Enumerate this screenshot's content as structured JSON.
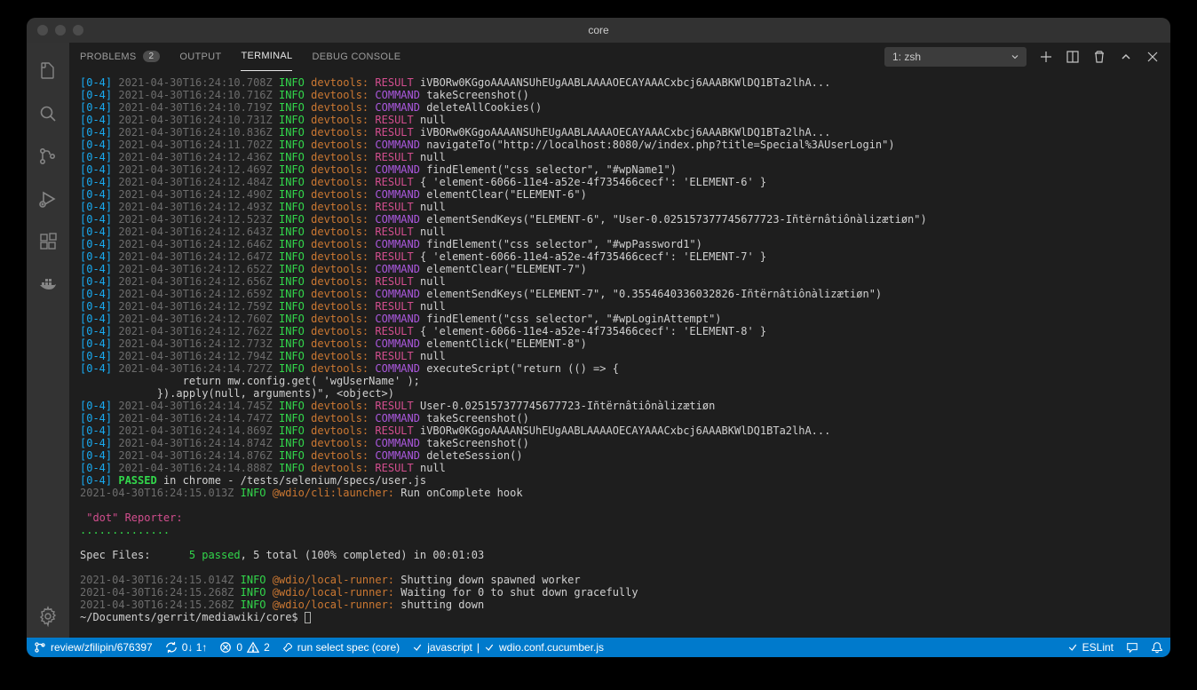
{
  "window": {
    "title": "core"
  },
  "panel_tabs": {
    "problems": "PROBLEMS",
    "problems_badge": "2",
    "output": "OUTPUT",
    "terminal": "TERMINAL",
    "debug_console": "DEBUG CONSOLE"
  },
  "terminal_select": "1: zsh",
  "log": {
    "prefix": "[0-4]",
    "info": "INFO",
    "source": "devtools:",
    "result": "RESULT",
    "command": "COMMAND",
    "lines": [
      {
        "ts": "2021-04-30T16:24:10.708Z",
        "kind": "RESULT",
        "msg": "iVBORw0KGgoAAAANSUhEUgAABLAAAAOECAYAAACxbcj6AAABKWlDQ1BTa2lhA..."
      },
      {
        "ts": "2021-04-30T16:24:10.716Z",
        "kind": "COMMAND",
        "msg": "takeScreenshot()"
      },
      {
        "ts": "2021-04-30T16:24:10.719Z",
        "kind": "COMMAND",
        "msg": "deleteAllCookies()"
      },
      {
        "ts": "2021-04-30T16:24:10.731Z",
        "kind": "RESULT",
        "msg": "null"
      },
      {
        "ts": "2021-04-30T16:24:10.836Z",
        "kind": "RESULT",
        "msg": "iVBORw0KGgoAAAANSUhEUgAABLAAAAOECAYAAACxbcj6AAABKWlDQ1BTa2lhA..."
      },
      {
        "ts": "2021-04-30T16:24:11.702Z",
        "kind": "COMMAND",
        "msg": "navigateTo(\"http://localhost:8080/w/index.php?title=Special%3AUserLogin\")"
      },
      {
        "ts": "2021-04-30T16:24:12.436Z",
        "kind": "RESULT",
        "msg": "null"
      },
      {
        "ts": "2021-04-30T16:24:12.469Z",
        "kind": "COMMAND",
        "msg": "findElement(\"css selector\", \"#wpName1\")"
      },
      {
        "ts": "2021-04-30T16:24:12.484Z",
        "kind": "RESULT",
        "msg": "{ 'element-6066-11e4-a52e-4f735466cecf': 'ELEMENT-6' }"
      },
      {
        "ts": "2021-04-30T16:24:12.490Z",
        "kind": "COMMAND",
        "msg": "elementClear(\"ELEMENT-6\")"
      },
      {
        "ts": "2021-04-30T16:24:12.493Z",
        "kind": "RESULT",
        "msg": "null"
      },
      {
        "ts": "2021-04-30T16:24:12.523Z",
        "kind": "COMMAND",
        "msg": "elementSendKeys(\"ELEMENT-6\", \"User-0.025157377745677723-Iñtërnâtiônàlizætiøn\")"
      },
      {
        "ts": "2021-04-30T16:24:12.643Z",
        "kind": "RESULT",
        "msg": "null"
      },
      {
        "ts": "2021-04-30T16:24:12.646Z",
        "kind": "COMMAND",
        "msg": "findElement(\"css selector\", \"#wpPassword1\")"
      },
      {
        "ts": "2021-04-30T16:24:12.647Z",
        "kind": "RESULT",
        "msg": "{ 'element-6066-11e4-a52e-4f735466cecf': 'ELEMENT-7' }"
      },
      {
        "ts": "2021-04-30T16:24:12.652Z",
        "kind": "COMMAND",
        "msg": "elementClear(\"ELEMENT-7\")"
      },
      {
        "ts": "2021-04-30T16:24:12.656Z",
        "kind": "RESULT",
        "msg": "null"
      },
      {
        "ts": "2021-04-30T16:24:12.659Z",
        "kind": "COMMAND",
        "msg": "elementSendKeys(\"ELEMENT-7\", \"0.3554640336032826-Iñtërnâtiônàlizætiøn\")"
      },
      {
        "ts": "2021-04-30T16:24:12.759Z",
        "kind": "RESULT",
        "msg": "null"
      },
      {
        "ts": "2021-04-30T16:24:12.760Z",
        "kind": "COMMAND",
        "msg": "findElement(\"css selector\", \"#wpLoginAttempt\")"
      },
      {
        "ts": "2021-04-30T16:24:12.762Z",
        "kind": "RESULT",
        "msg": "{ 'element-6066-11e4-a52e-4f735466cecf': 'ELEMENT-8' }"
      },
      {
        "ts": "2021-04-30T16:24:12.773Z",
        "kind": "COMMAND",
        "msg": "elementClick(\"ELEMENT-8\")"
      },
      {
        "ts": "2021-04-30T16:24:12.794Z",
        "kind": "RESULT",
        "msg": "null"
      },
      {
        "ts": "2021-04-30T16:24:14.727Z",
        "kind": "COMMAND",
        "msg": "executeScript(\"return (() => {"
      },
      {
        "cont": "                return mw.config.get( 'wgUserName' );"
      },
      {
        "cont": "            }).apply(null, arguments)\", <object>)"
      },
      {
        "ts": "2021-04-30T16:24:14.745Z",
        "kind": "RESULT",
        "msg": "User-0.025157377745677723-Iñtërnâtiônàlizætiøn"
      },
      {
        "ts": "2021-04-30T16:24:14.747Z",
        "kind": "COMMAND",
        "msg": "takeScreenshot()"
      },
      {
        "ts": "2021-04-30T16:24:14.869Z",
        "kind": "RESULT",
        "msg": "iVBORw0KGgoAAAANSUhEUgAABLAAAAOECAYAAACxbcj6AAABKWlDQ1BTa2lhA..."
      },
      {
        "ts": "2021-04-30T16:24:14.874Z",
        "kind": "COMMAND",
        "msg": "takeScreenshot()"
      },
      {
        "ts": "2021-04-30T16:24:14.876Z",
        "kind": "COMMAND",
        "msg": "deleteSession()"
      },
      {
        "ts": "2021-04-30T16:24:14.888Z",
        "kind": "RESULT",
        "msg": "null"
      }
    ],
    "passed_line": {
      "prefix": "[0-4]",
      "status": "PASSED",
      "rest": " in chrome - /tests/selenium/specs/user.js"
    },
    "launcher_line": {
      "ts": "2021-04-30T16:24:15.013Z",
      "src": "@wdio/cli:launcher:",
      "msg": "Run onComplete hook"
    },
    "reporter_header": " \"dot\" Reporter:",
    "dots": "..............",
    "spec_label": "Spec Files:",
    "spec_passed": "5 passed",
    "spec_rest": ", 5 total (100% completed) in 00:01:03",
    "shutdown": [
      {
        "ts": "2021-04-30T16:24:15.014Z",
        "src": "@wdio/local-runner:",
        "msg": "Shutting down spawned worker"
      },
      {
        "ts": "2021-04-30T16:24:15.268Z",
        "src": "@wdio/local-runner:",
        "msg": "Waiting for 0 to shut down gracefully"
      },
      {
        "ts": "2021-04-30T16:24:15.268Z",
        "src": "@wdio/local-runner:",
        "msg": "shutting down"
      }
    ],
    "prompt": "~/Documents/gerrit/mediawiki/core$ "
  },
  "status_bar": {
    "branch": "review/zfilipin/676397",
    "sync": "0↓ 1↑",
    "errors": "0",
    "warnings": "2",
    "task": "run select spec (core)",
    "lang": "javascript",
    "config": "wdio.conf.cucumber.js",
    "eslint": "ESLint"
  }
}
